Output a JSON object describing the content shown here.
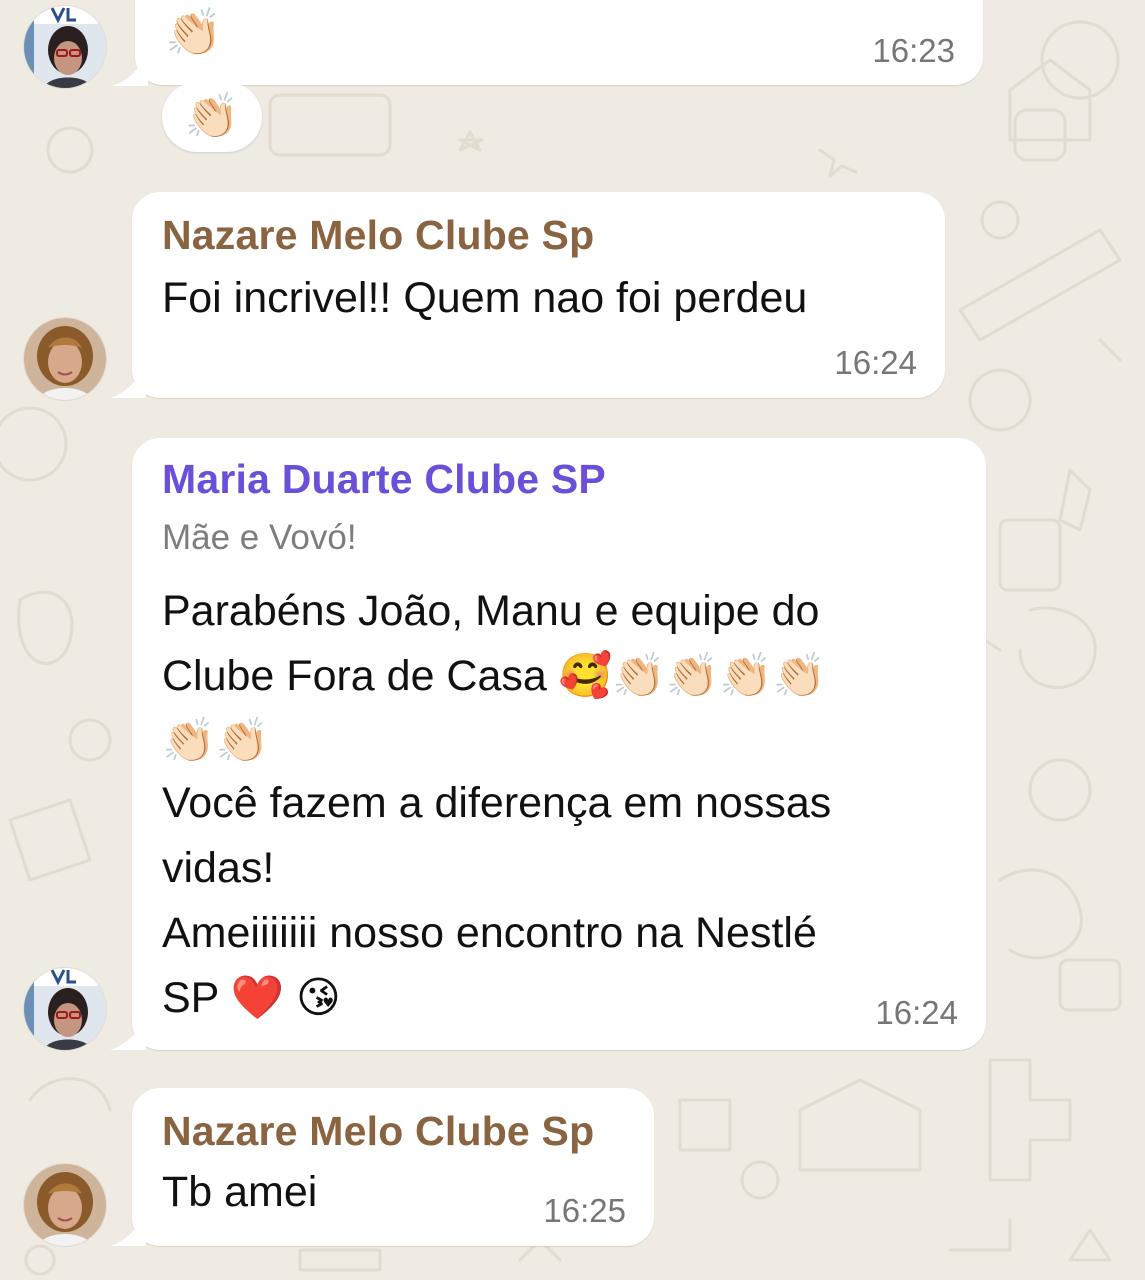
{
  "colors": {
    "background": "#efeae2",
    "bubble": "#ffffff",
    "sender_nazare": "#8a6341",
    "sender_maria": "#6b4fd8",
    "timestamp": "#767676",
    "subtitle": "#7d7d7d"
  },
  "messages": [
    {
      "emoji": "👏🏻",
      "time": "16:23",
      "reaction": "👏🏻"
    },
    {
      "sender": "Nazare Melo Clube Sp",
      "text": "Foi incrivel!! Quem nao foi perdeu",
      "time": "16:24"
    },
    {
      "sender": "Maria Duarte Clube SP",
      "subtitle": "Mãe e Vovó!",
      "lines": [
        "Parabéns João, Manu e equipe do",
        "Clube Fora de Casa 🥰👏🏻👏🏻👏🏻👏🏻",
        "👏🏻👏🏻",
        "Você fazem a diferença em nossas",
        "vidas!",
        "Ameiiiiiii nosso encontro na Nestlé",
        "SP ❤️ 😘"
      ],
      "time": "16:24"
    },
    {
      "sender": "Nazare Melo Clube Sp",
      "text": "Tb amei",
      "time": "16:25"
    }
  ],
  "avatars": [
    {
      "icon": "maria-duarte-avatar"
    },
    {
      "icon": "nazare-melo-avatar"
    },
    {
      "icon": "maria-duarte-avatar"
    },
    {
      "icon": "nazare-melo-avatar"
    }
  ]
}
